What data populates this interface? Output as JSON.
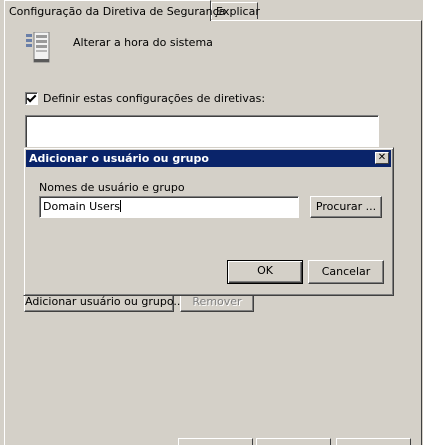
{
  "tabs": [
    {
      "label": "Configuração da Diretiva de Segurança",
      "active": true
    },
    {
      "label": "Explicar",
      "active": false
    }
  ],
  "policy": {
    "icon": "server-icon",
    "name": "Alterar a hora do sistema"
  },
  "define_settings": {
    "label": "Definir estas configurações de diretivas:",
    "checked": true
  },
  "panel_buttons": {
    "add": "Adicionar usuário ou grupo...",
    "remove": "Remover"
  },
  "dialog": {
    "title": "Adicionar o usuário ou grupo",
    "close_symbol": "✕",
    "field_label": "Nomes de usuário e grupo",
    "field_value": "Domain Users",
    "browse": "Procurar ...",
    "ok": "OK",
    "cancel": "Cancelar"
  },
  "colors": {
    "face": "#d4d0c8",
    "title_bar": "#0a246a"
  }
}
